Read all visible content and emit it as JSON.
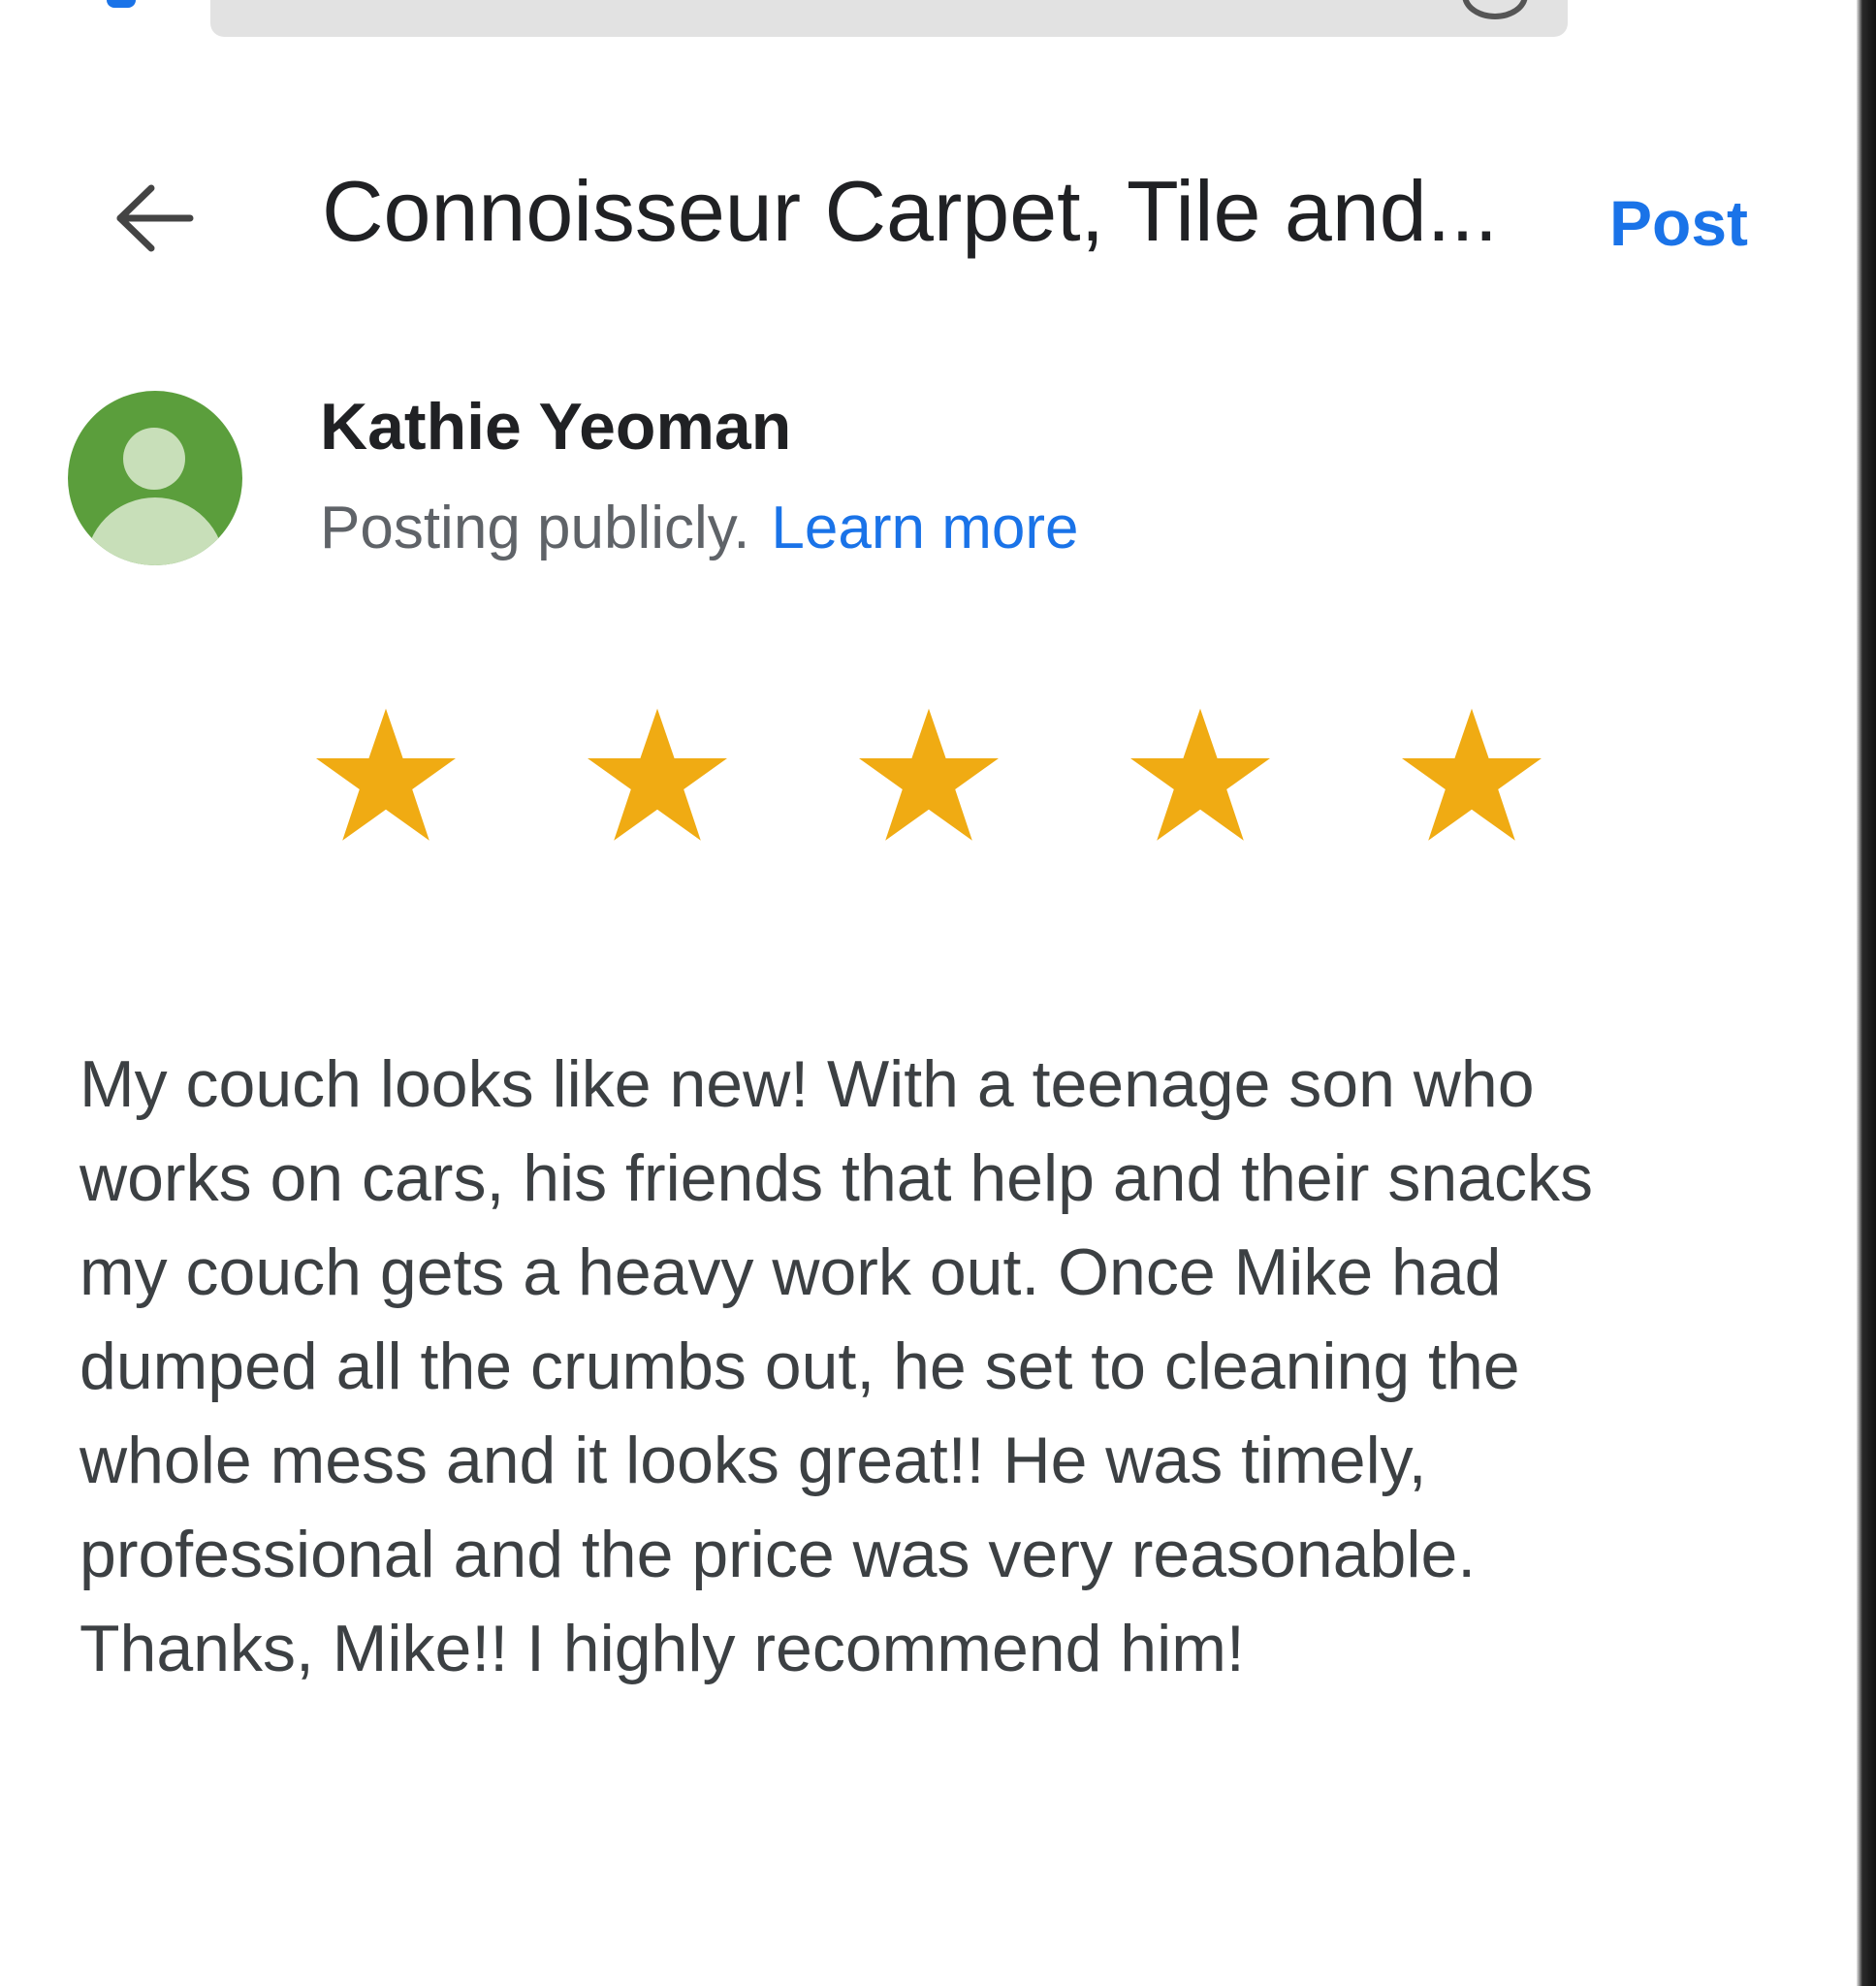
{
  "browser": {
    "url_field": ""
  },
  "header": {
    "title": "Connoisseur Carpet, Tile and...",
    "post_label": "Post",
    "back_icon": "arrow-left-icon"
  },
  "user": {
    "name": "Kathie Yeoman",
    "posting_text": "Posting publicly.",
    "learn_more_label": "Learn more",
    "avatar_icon": "default-person-avatar",
    "avatar_color": "#5b9e3c"
  },
  "rating": {
    "value": 5,
    "max": 5,
    "star_color": "#f0ab13"
  },
  "review": {
    "text": "My couch looks like new! With a teenage son who\nworks on cars, his friends that help and their snacks\nmy couch gets a heavy work out. Once Mike had\ndumped all the crumbs out, he set to cleaning the\nwhole mess and it looks great!! He was timely,\nprofessional and the price was very reasonable.\nThanks, Mike!! I highly recommend him!"
  },
  "colors": {
    "accent": "#1a73e8",
    "text_primary": "#202124",
    "text_secondary": "#5f6368"
  }
}
